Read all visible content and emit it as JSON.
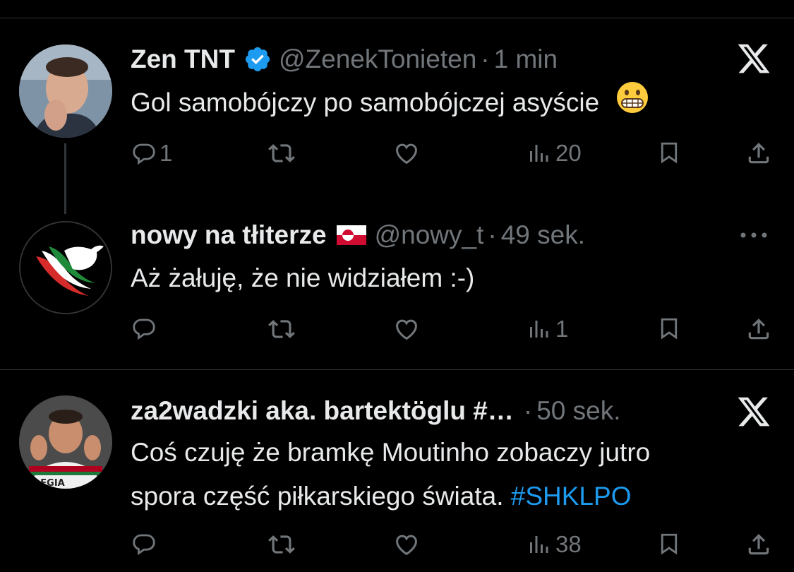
{
  "tweets": [
    {
      "name": "Zen TNT",
      "verified": true,
      "handle": "@ZenekTonieten",
      "time": "1 min",
      "text": "Gol samobójczy po samobójczej asyście",
      "emoji": "grimacing-face",
      "replies": "1",
      "retweets": "",
      "likes": "",
      "views": "20",
      "corner_icon": "x-logo-icon"
    },
    {
      "name": "nowy na tłiterze",
      "flag": "greenland-flag",
      "handle": "@nowy_t",
      "time": "49 sek.",
      "text": "Aż żałuję, że nie widziałem :-)",
      "replies": "",
      "retweets": "",
      "likes": "",
      "views": "1",
      "corner_icon": "more-icon"
    },
    {
      "name": "za2wadzki aka. bartektöglu #…",
      "handle": "",
      "time": "50 sek.",
      "text_line1": "Coś czuję że bramkę Moutinho zobaczy jutro",
      "text_line2_plain": "spora część piłkarskiego świata.",
      "text_line2_hashtag": "#SHKLPO",
      "replies": "",
      "retweets": "",
      "likes": "",
      "views": "38",
      "corner_icon": "x-logo-icon",
      "avatar_shirt_text": "LEGIA"
    }
  ],
  "colors": {
    "background": "#000000",
    "text": "#e7e9ea",
    "muted": "#71767b",
    "link": "#1d9bf0",
    "verified": "#1d9bf0",
    "divider": "#2f3336"
  }
}
